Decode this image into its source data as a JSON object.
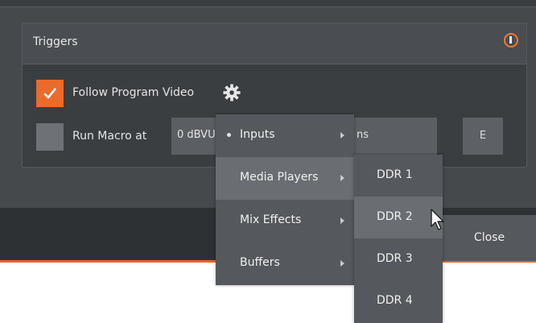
{
  "panel": {
    "title": "Triggers",
    "info_icon": "info-icon"
  },
  "options": {
    "follow_label": "Follow Program Video",
    "follow_checked": true,
    "gear_icon": "gear-icon",
    "run_macro_label": "Run Macro at",
    "run_macro_checked": false,
    "level_value": "0 dBVU",
    "macro_value_tail": "ns",
    "e_button_label": "E"
  },
  "dialog": {
    "close_label": "Close"
  },
  "menu": {
    "items": [
      {
        "label": "Inputs",
        "has_submenu": true,
        "bullet": true
      },
      {
        "label": "Media Players",
        "has_submenu": true,
        "highlighted": true
      },
      {
        "label": "Mix Effects",
        "has_submenu": true
      },
      {
        "label": "Buffers",
        "has_submenu": true
      }
    ],
    "submenu": {
      "items": [
        {
          "label": "DDR 1"
        },
        {
          "label": "DDR 2",
          "highlighted": true
        },
        {
          "label": "DDR 3"
        },
        {
          "label": "DDR 4"
        }
      ]
    }
  },
  "colors": {
    "accent": "#ec6a2a",
    "dialog_bg": "#46494c",
    "menu_bg": "#55585c",
    "menu_highlight": "#6a6e72"
  }
}
